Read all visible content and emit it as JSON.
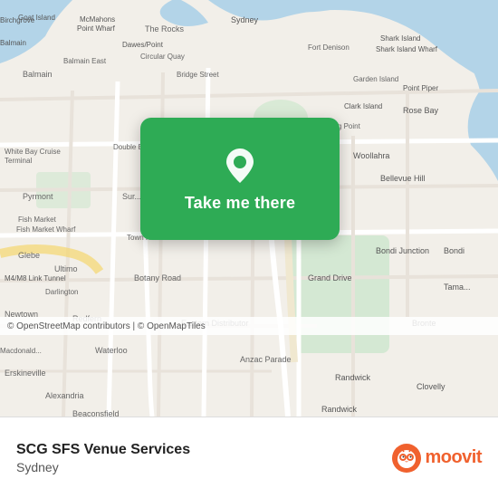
{
  "map": {
    "alt": "Map of Sydney showing SCG SFS Venue Services location",
    "attribution": "© OpenStreetMap contributors | © OpenMapTiles"
  },
  "card": {
    "button_label": "Take me there",
    "pin_alt": "location-pin"
  },
  "footer": {
    "venue_name": "SCG SFS Venue Services",
    "venue_city": "Sydney",
    "moovit_brand": "moovit"
  }
}
